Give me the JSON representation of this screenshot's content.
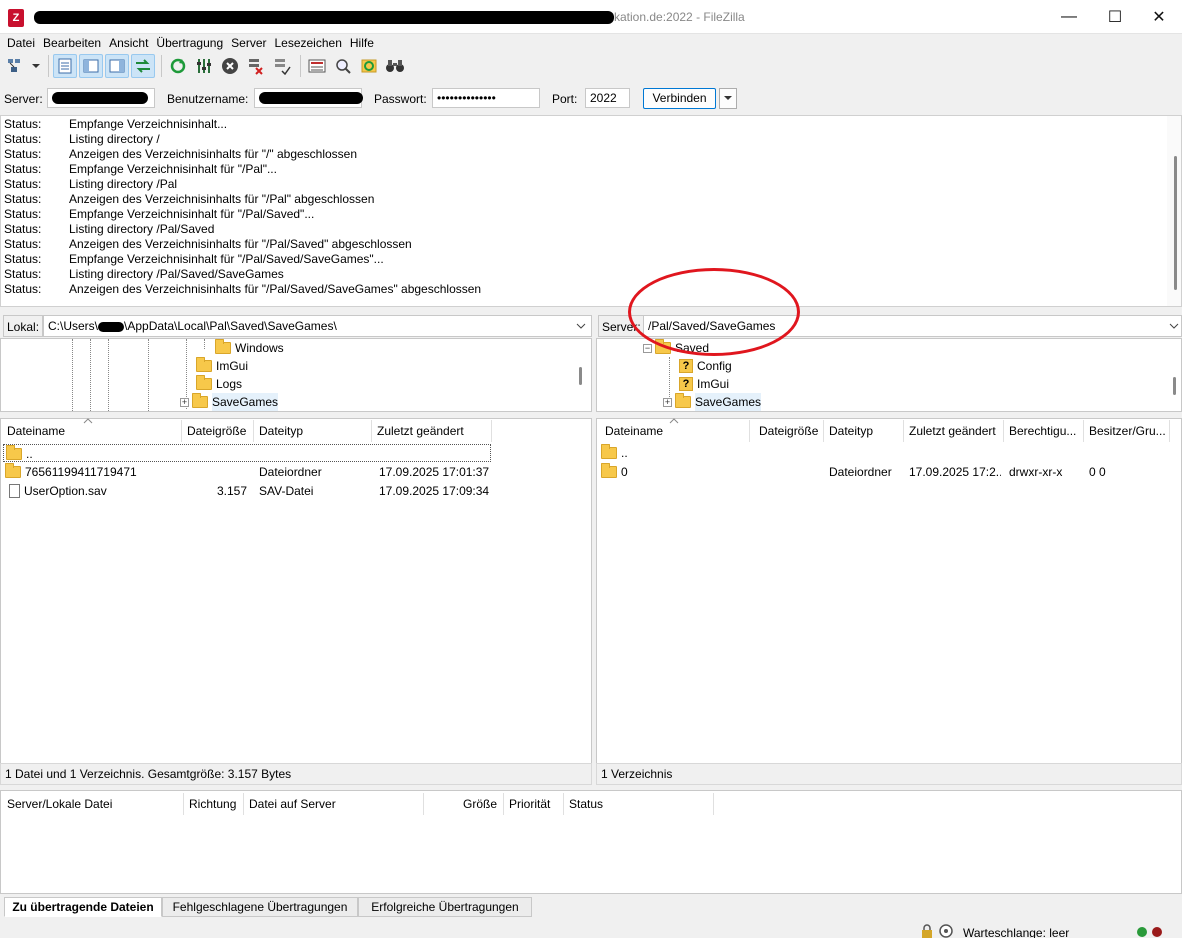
{
  "titlebar": {
    "title_tail": "kation.de:2022 - FileZilla",
    "minimize": "—",
    "maximize": "☐",
    "close": "✕",
    "icon": "filezilla-icon"
  },
  "menu": [
    "Datei",
    "Bearbeiten",
    "Ansicht",
    "Übertragung",
    "Server",
    "Lesezeichen",
    "Hilfe"
  ],
  "quickconnect": {
    "server_label": "Server:",
    "user_label": "Benutzername:",
    "pass_label": "Passwort:",
    "pass_value": "••••••••••••••",
    "port_label": "Port:",
    "port_value": "2022",
    "connect_label": "Verbinden"
  },
  "log": [
    [
      "Status:",
      "Empfange Verzeichnisinhalt..."
    ],
    [
      "Status:",
      "Listing directory /"
    ],
    [
      "Status:",
      "Anzeigen des Verzeichnisinhalts für \"/\" abgeschlossen"
    ],
    [
      "Status:",
      "Empfange Verzeichnisinhalt für \"/Pal\"..."
    ],
    [
      "Status:",
      "Listing directory /Pal"
    ],
    [
      "Status:",
      "Anzeigen des Verzeichnisinhalts für \"/Pal\" abgeschlossen"
    ],
    [
      "Status:",
      "Empfange Verzeichnisinhalt für \"/Pal/Saved\"..."
    ],
    [
      "Status:",
      "Listing directory /Pal/Saved"
    ],
    [
      "Status:",
      "Anzeigen des Verzeichnisinhalts für \"/Pal/Saved\" abgeschlossen"
    ],
    [
      "Status:",
      "Empfange Verzeichnisinhalt für \"/Pal/Saved/SaveGames\"..."
    ],
    [
      "Status:",
      "Listing directory /Pal/Saved/SaveGames"
    ],
    [
      "Status:",
      "Anzeigen des Verzeichnisinhalts für \"/Pal/Saved/SaveGames\" abgeschlossen"
    ]
  ],
  "local": {
    "label": "Lokal:",
    "path_prefix": "C:\\Users\\",
    "path_suffix": "\\AppData\\Local\\Pal\\Saved\\SaveGames\\",
    "tree": [
      "Windows",
      "ImGui",
      "Logs",
      "SaveGames"
    ],
    "headers": [
      "Dateiname",
      "Dateigröße",
      "Dateityp",
      "Zuletzt geändert"
    ],
    "rows": [
      {
        "name": "..",
        "size": "",
        "type": "",
        "modified": ""
      },
      {
        "name": "76561199411719471",
        "size": "",
        "type": "Dateiordner",
        "modified": "17.09.2025 17:01:37"
      },
      {
        "name": "UserOption.sav",
        "size": "3.157",
        "type": "SAV-Datei",
        "modified": "17.09.2025 17:09:34"
      }
    ],
    "status": "1 Datei und 1 Verzeichnis. Gesamtgröße: 3.157 Bytes"
  },
  "remote": {
    "label": "Server:",
    "path": "/Pal/Saved/SaveGames",
    "tree": [
      "Saved",
      "Config",
      "ImGui",
      "SaveGames"
    ],
    "headers": [
      "Dateiname",
      "Dateigröße",
      "Dateityp",
      "Zuletzt geändert",
      "Berechtigu...",
      "Besitzer/Gru..."
    ],
    "rows": [
      {
        "name": "..",
        "size": "",
        "type": "",
        "modified": "",
        "perms": "",
        "owner": ""
      },
      {
        "name": "0",
        "size": "",
        "type": "Dateiordner",
        "modified": "17.09.2025 17:2...",
        "perms": "drwxr-xr-x",
        "owner": "0 0"
      }
    ],
    "status": "1 Verzeichnis"
  },
  "queue": {
    "headers": [
      "Server/Lokale Datei",
      "Richtung",
      "Datei auf Server",
      "Größe",
      "Priorität",
      "Status"
    ],
    "tabs": [
      "Zu übertragende Dateien",
      "Fehlgeschlagene Übertragungen",
      "Erfolgreiche Übertragungen"
    ]
  },
  "statusbar": {
    "queue_text": "Warteschlange: leer"
  },
  "colors": {
    "annotation": "#e0161e",
    "folder": "#f7c84a",
    "accent": "#0078d4"
  }
}
